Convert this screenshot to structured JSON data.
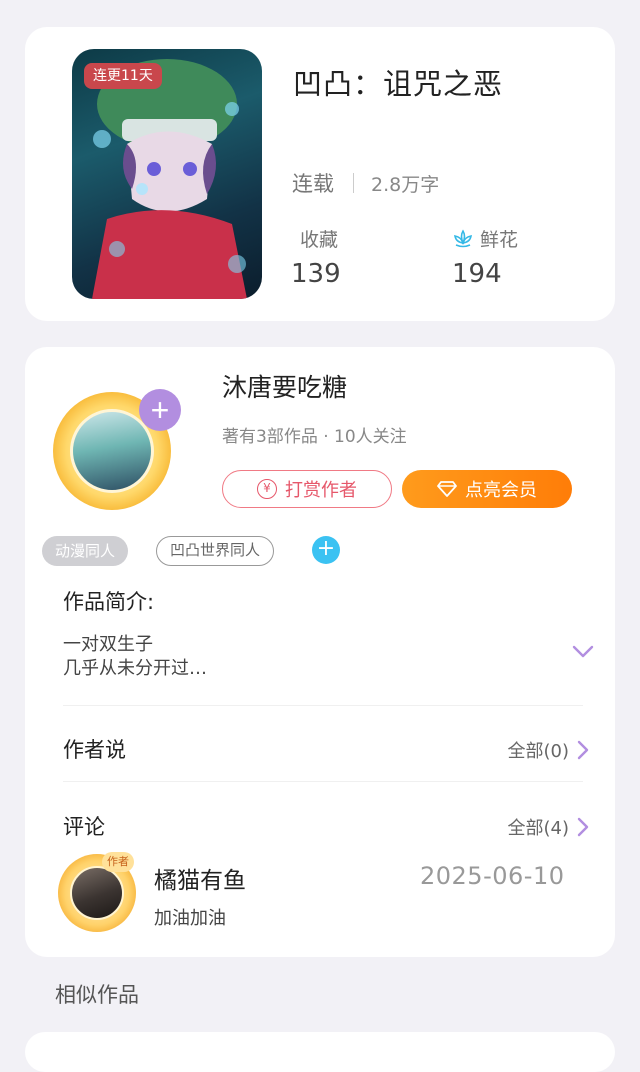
{
  "book": {
    "cover_badge": "连更11天",
    "title": "凹凸：诅咒之恶",
    "status": "连载",
    "word_count": "2.8万字",
    "favorites_label": "收藏",
    "favorites_value": "139",
    "flowers_label": "鲜花",
    "flowers_value": "194",
    "flower_icon": "lotus-icon"
  },
  "author": {
    "name": "沐唐要吃糖",
    "meta": "著有3部作品 · 10人关注",
    "follow_label": "+",
    "tip_label": "打赏作者",
    "tip_icon": "yen-icon",
    "vip_label": "点亮会员",
    "vip_icon": "diamond-icon",
    "tags": [
      "动漫同人",
      "凹凸世界同人"
    ],
    "tag_add": "+"
  },
  "intro": {
    "title": "作品简介:",
    "lines": [
      "一对双生子",
      "几乎从未分开过…"
    ]
  },
  "author_says": {
    "title": "作者说",
    "all_label": "全部(0)"
  },
  "comments": {
    "title": "评论",
    "all_label": "全部(4)",
    "items": [
      {
        "badge": "作者",
        "user": "橘猫有鱼",
        "text": "加油加油",
        "date": "2025-06-10"
      }
    ]
  },
  "similar": {
    "title": "相似作品"
  },
  "colors": {
    "accent_purple": "#b28ee0",
    "vip_orange": "#ff8a0f",
    "tip_red": "#e6576a",
    "tag_blue": "#3bc2f2",
    "badge_red": "#c9474c"
  }
}
